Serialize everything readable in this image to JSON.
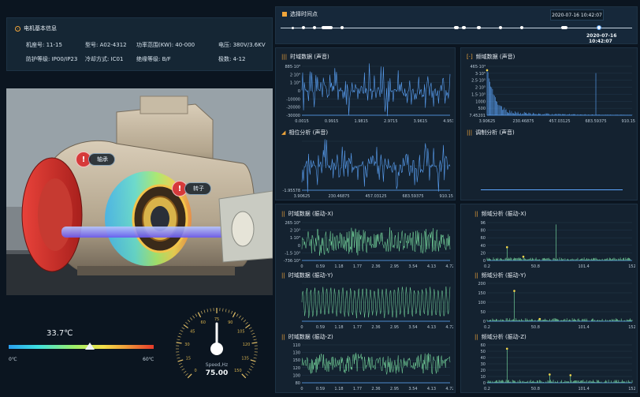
{
  "motor_info": {
    "title": "电机基本信息",
    "row1": [
      "机座号: 11-15",
      "型号: A02-4312",
      "功率范围(KW): 40-000",
      "电压: 380V/3.6KV"
    ],
    "row2": [
      "防护等级: IP00/IP23",
      "冷却方式: IC01",
      "绝缘等级: B/F",
      "极数: 4-12"
    ]
  },
  "timeline": {
    "title": "选择时间点",
    "current_datetime": "2020-07-16 10:42:07",
    "marker_date": "2020-07-16",
    "marker_time": "10:42:07"
  },
  "badges": {
    "bearing": "轴承",
    "rotor": "转子"
  },
  "temperature": {
    "value": "33.7℃",
    "min_label": "0℃",
    "max_label": "60℃",
    "level": 0.56
  },
  "gauge": {
    "label": "Speed,Hz",
    "value": "75.00",
    "value_num": 75,
    "max": 150,
    "ticks": [
      "0",
      "15",
      "30",
      "45",
      "60",
      "75",
      "90",
      "105",
      "120",
      "135",
      "150"
    ],
    "tick_values": [
      0,
      15,
      30,
      45,
      60,
      75,
      90,
      105,
      120,
      135,
      150
    ]
  },
  "colors": {
    "accent": "#f0a53a",
    "line_blue": "#5ea8ff",
    "line_green": "#7fe8a8",
    "background": "#0b1520",
    "panel": "#142230"
  },
  "charts": {
    "sound_time": {
      "title": "时域数据 (声音)",
      "yticks": [
        "885·10³",
        "2·10⁴",
        "1·10⁴",
        "0",
        "-10000",
        "-20000",
        "-30000"
      ],
      "xticks": [
        "0.0015",
        "0.9915",
        "1.9815",
        "2.9715",
        "3.9615",
        "4.9515"
      ]
    },
    "sound_freq": {
      "title": "频域数据 (声音)",
      "yticks": [
        "465·10⁴",
        "3·10⁵",
        "2.5·10⁵",
        "2·10⁵",
        "1.5·10⁵",
        "1000",
        "500",
        "7.45201"
      ],
      "xticks": [
        "3.90625",
        "230.46875",
        "457.03125",
        "683.59375",
        "910.15625"
      ]
    },
    "phase": {
      "title": "相位分析 (声音)",
      "yticks": [
        "",
        "",
        "-1.95578"
      ],
      "xticks": [
        "3.90625",
        "230.46875",
        "457.03125",
        "683.59375",
        "910.15625"
      ]
    },
    "demod": {
      "title": "调制分析 (声音)"
    },
    "vib_x_time": {
      "title": "时域数据 (振动-X)",
      "yticks": [
        "265·10³",
        "2·10³",
        "1·10³",
        "0",
        "-1.5·10³",
        "-736·10³"
      ],
      "xticks": [
        "0",
        "0.59",
        "1.18",
        "1.77",
        "2.36",
        "2.95",
        "3.54",
        "4.13",
        "4.72"
      ]
    },
    "vib_x_freq": {
      "title": "频域分析 (振动-X)",
      "yticks": [
        "96",
        "80",
        "60",
        "40",
        "20",
        "0"
      ],
      "xticks": [
        "0.2",
        "50.8",
        "101.4",
        "152"
      ]
    },
    "vib_y_time": {
      "title": "时域数据 (振动-Y)",
      "yticks": [
        "",
        "",
        "",
        "",
        ""
      ],
      "xticks": [
        "0",
        "0.59",
        "1.18",
        "1.77",
        "2.36",
        "2.95",
        "3.54",
        "4.13",
        "4.72"
      ]
    },
    "vib_y_freq": {
      "title": "频域分析 (振动-Y)",
      "yticks": [
        "200",
        "150",
        "100",
        "50",
        "0"
      ],
      "xticks": [
        "0.2",
        "50.8",
        "101.4",
        "152"
      ]
    },
    "vib_z_time": {
      "title": "时域数据 (振动-Z)",
      "yticks": [
        "110",
        "130",
        "150",
        "120",
        "100",
        "80"
      ],
      "xticks": [
        "0",
        "0.59",
        "1.18",
        "1.77",
        "2.36",
        "2.95",
        "3.54",
        "4.13",
        "4.72"
      ]
    },
    "vib_z_freq": {
      "title": "频域分析 (振动-Z)",
      "yticks": [
        "60",
        "50",
        "40",
        "30",
        "20",
        "10",
        "0"
      ],
      "xticks": [
        "0.2",
        "50.8",
        "101.4",
        "152"
      ]
    }
  }
}
